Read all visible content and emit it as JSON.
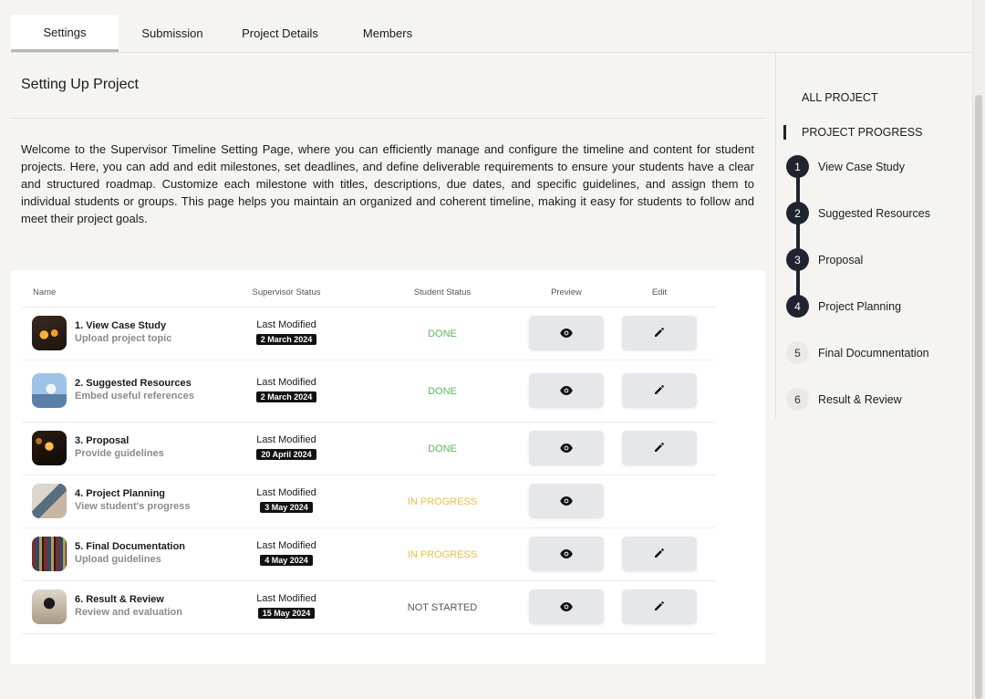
{
  "tabs": [
    {
      "label": "Settings"
    },
    {
      "label": "Submission"
    },
    {
      "label": "Project Details"
    },
    {
      "label": "Members"
    }
  ],
  "page": {
    "title": "Setting Up Project",
    "intro": "Welcome to the Supervisor Timeline Setting Page, where you can efficiently manage and configure the timeline and content for student projects. Here, you can add and edit milestones, set deadlines, and define deliverable requirements to ensure your students have a clear and structured roadmap. Customize each milestone with titles, descriptions, due dates, and specific guidelines, and assign them to individual students or groups. This page helps you maintain an organized and coherent timeline, making it easy for students to follow and meet their project goals."
  },
  "table": {
    "headers": {
      "name": "Name",
      "supervisor_status": "Supervisor Status",
      "student_status": "Student Status",
      "preview": "Preview",
      "edit": "Edit"
    },
    "rows": [
      {
        "title": "1. View Case Study",
        "subtitle": "Upload project topic",
        "modified_label": "Last Modified",
        "date": "2 March 2024",
        "status": "DONE",
        "status_color": "#5cb85c",
        "has_edit": true
      },
      {
        "title": "2. Suggested Resources",
        "subtitle": "Embed useful references",
        "modified_label": "Last Modified",
        "date": "2 March 2024",
        "status": "DONE",
        "status_color": "#5cb85c",
        "has_edit": true
      },
      {
        "title": "3. Proposal",
        "subtitle": "Provide guidelines",
        "modified_label": "Last Modified",
        "date": "20 April 2024",
        "status": "DONE",
        "status_color": "#5cb85c",
        "has_edit": true
      },
      {
        "title": "4. Project Planning",
        "subtitle": "View student's progress",
        "modified_label": "Last Modified",
        "date": "3 May 2024",
        "status": "IN PROGRESS",
        "status_color": "#e7c14b",
        "has_edit": false
      },
      {
        "title": "5. Final Documentation",
        "subtitle": "Upload guidelines",
        "modified_label": "Last Modified",
        "date": "4 May 2024",
        "status": "IN PROGRESS",
        "status_color": "#e7c14b",
        "has_edit": true
      },
      {
        "title": "6. Result & Review",
        "subtitle": "Review and evaluation",
        "modified_label": "Last Modified",
        "date": "15 May 2024",
        "status": "NOT STARTED",
        "status_color": "#555555",
        "has_edit": true
      }
    ]
  },
  "sidebar": {
    "all_project": "ALL PROJECT",
    "project_progress": "PROJECT PROGRESS",
    "steps": [
      {
        "num": "1",
        "label": "View Case Study",
        "active": true
      },
      {
        "num": "2",
        "label": "Suggested Resources",
        "active": true
      },
      {
        "num": "3",
        "label": "Proposal",
        "active": true
      },
      {
        "num": "4",
        "label": "Project Planning",
        "active": true
      },
      {
        "num": "5",
        "label": "Final Documnentation",
        "active": false
      },
      {
        "num": "6",
        "label": "Result & Review",
        "active": false
      }
    ]
  },
  "icons": {
    "preview": "eye-icon",
    "edit": "pencil-icon"
  }
}
